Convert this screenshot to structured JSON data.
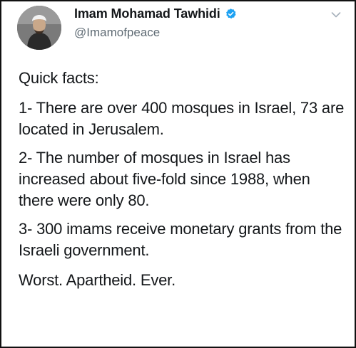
{
  "tweet": {
    "author": {
      "display_name": "Imam Mohamad Tawhidi",
      "handle": "@Imamofpeace",
      "verified": true,
      "avatar_icon": "profile-photo",
      "verified_icon": "verified-badge-icon",
      "verified_color": "#1da1f2"
    },
    "menu_icon": "chevron-down-icon",
    "paragraphs": [
      "Quick facts:",
      "1- There are over 400 mosques in Israel, 73 are located in Jerusalem.",
      "2- The number of mosques in Israel has increased about five-fold since 1988, when there were only 80.",
      "3- 300 imams receive monetary grants from the Israeli government.",
      "Worst. Apartheid. Ever."
    ]
  },
  "colors": {
    "text": "#14171a",
    "secondary_text": "#5f6b74",
    "border": "#111111",
    "background": "#ffffff"
  }
}
